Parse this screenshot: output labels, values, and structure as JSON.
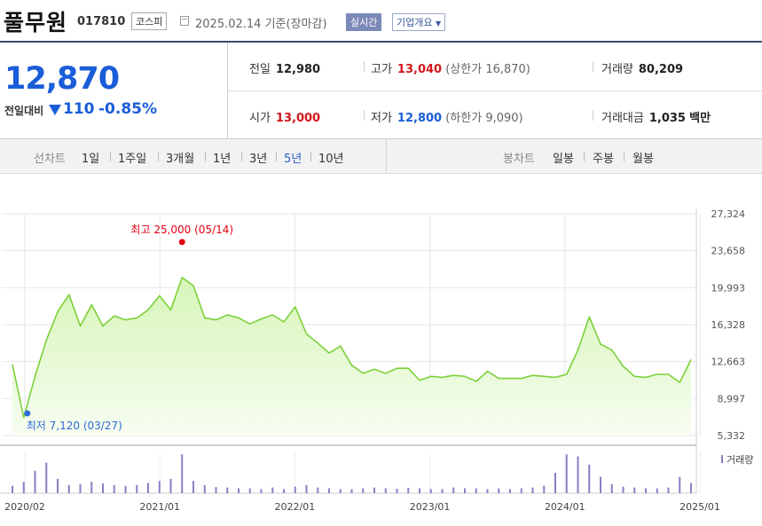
{
  "header": {
    "name": "풀무원",
    "code": "017810",
    "market": "코스피",
    "date": "2025.02.14",
    "date_suffix": "기준(장마감)",
    "realtime": "실시간",
    "company_info": "기업개요"
  },
  "quote": {
    "price": "12,870",
    "change_label": "전일대비",
    "change": "110",
    "change_pct": "-0.85%"
  },
  "stats": {
    "prev_close_label": "전일",
    "prev_close": "12,980",
    "high_label": "고가",
    "high": "13,040",
    "upper_limit": "(상한가 16,870)",
    "volume_label": "거래량",
    "volume": "80,209",
    "open_label": "시가",
    "open": "13,000",
    "low_label": "저가",
    "low": "12,800",
    "lower_limit": "(하한가 9,090)",
    "amount_label": "거래대금",
    "amount": "1,035",
    "amount_unit": "백만"
  },
  "tabs": {
    "line_label": "선차트",
    "line_periods": [
      "1일",
      "1주일",
      "3개월",
      "1년",
      "3년",
      "5년",
      "10년"
    ],
    "active_period": "5년",
    "candle_label": "봉차트",
    "candle_periods": [
      "일봉",
      "주봉",
      "월봉"
    ]
  },
  "colors": {
    "line": "#7cd13a",
    "area_top": "#d6f5b8",
    "area_bottom": "#f7fdf1",
    "volume": "#8a7fc6",
    "max": "#e10011",
    "min": "#2e6bd6"
  },
  "chart_data": {
    "type": "area",
    "ylim": [
      5332,
      27324
    ],
    "y_ticks": [
      "27,324",
      "23,658",
      "19,993",
      "16,328",
      "12,663",
      "8,997",
      "5,332"
    ],
    "x_ticks": [
      "2020/02",
      "2021/01",
      "2022/01",
      "2023/01",
      "2024/01",
      "2025/01"
    ],
    "max_label": "최고 25,000 (05/14)",
    "min_label": "최저 7,120 (03/27)",
    "volume_label": "거래량",
    "series": [
      {
        "x": [
          "2020-02",
          "2020-03",
          "2020-04",
          "2020-05",
          "2020-06",
          "2020-07",
          "2020-08",
          "2020-09",
          "2020-10",
          "2020-11",
          "2020-12",
          "2021-01",
          "2021-02",
          "2021-03",
          "2021-04",
          "2021-05",
          "2021-06",
          "2021-07",
          "2021-08",
          "2021-09",
          "2021-10",
          "2021-11",
          "2021-12",
          "2022-01",
          "2022-02",
          "2022-03",
          "2022-04",
          "2022-05",
          "2022-06",
          "2022-07",
          "2022-08",
          "2022-09",
          "2022-10",
          "2022-11",
          "2022-12",
          "2023-01",
          "2023-02",
          "2023-03",
          "2023-04",
          "2023-05",
          "2023-06",
          "2023-07",
          "2023-08",
          "2023-09",
          "2023-10",
          "2023-11",
          "2023-12",
          "2024-01",
          "2024-02",
          "2024-03",
          "2024-04",
          "2024-05",
          "2024-06",
          "2024-07",
          "2024-08",
          "2024-09",
          "2024-10",
          "2024-11",
          "2024-12",
          "2025-01",
          "2025-02"
        ],
        "values": [
          12400,
          7120,
          11200,
          14800,
          17600,
          19300,
          16200,
          18300,
          16200,
          17200,
          16800,
          17000,
          17800,
          19200,
          17800,
          21000,
          20200,
          17000,
          16800,
          17300,
          17000,
          16400,
          16900,
          17300,
          16600,
          18100,
          15400,
          14500,
          13500,
          14200,
          12300,
          11500,
          11900,
          11500,
          12000,
          12000,
          10800,
          11200,
          11100,
          11300,
          11200,
          10700,
          11700,
          11000,
          11000,
          11000,
          11300,
          11200,
          11100,
          11400,
          13800,
          17100,
          14400,
          13800,
          12200,
          11200,
          11100,
          11400,
          11400,
          10600,
          12870
        ]
      },
      {
        "name": "거래량",
        "x": [
          "2020-02",
          "2020-03",
          "2020-04",
          "2020-05",
          "2020-06",
          "2020-07",
          "2020-08",
          "2020-09",
          "2020-10",
          "2020-11",
          "2020-12",
          "2021-01",
          "2021-02",
          "2021-03",
          "2021-04",
          "2021-05",
          "2021-06",
          "2021-07",
          "2021-08",
          "2021-09",
          "2021-10",
          "2021-11",
          "2021-12",
          "2022-01",
          "2022-02",
          "2022-03",
          "2022-04",
          "2022-05",
          "2022-06",
          "2022-07",
          "2022-08",
          "2022-09",
          "2022-10",
          "2022-11",
          "2022-12",
          "2023-01",
          "2023-02",
          "2023-03",
          "2023-04",
          "2023-05",
          "2023-06",
          "2023-07",
          "2023-08",
          "2023-09",
          "2023-10",
          "2023-11",
          "2023-12",
          "2024-01",
          "2024-02",
          "2024-03",
          "2024-04",
          "2024-05",
          "2024-06",
          "2024-07",
          "2024-08",
          "2024-09",
          "2024-10",
          "2024-11",
          "2024-12",
          "2025-01",
          "2025-02"
        ],
        "values": [
          0.18,
          0.28,
          0.55,
          0.75,
          0.35,
          0.2,
          0.22,
          0.28,
          0.24,
          0.2,
          0.18,
          0.2,
          0.25,
          0.3,
          0.35,
          0.95,
          0.3,
          0.2,
          0.15,
          0.14,
          0.12,
          0.12,
          0.1,
          0.14,
          0.1,
          0.16,
          0.2,
          0.14,
          0.12,
          0.1,
          0.1,
          0.12,
          0.14,
          0.12,
          0.11,
          0.13,
          0.12,
          0.1,
          0.1,
          0.14,
          0.12,
          0.12,
          0.1,
          0.12,
          0.1,
          0.12,
          0.14,
          0.18,
          0.5,
          0.95,
          0.9,
          0.7,
          0.4,
          0.22,
          0.16,
          0.14,
          0.12,
          0.12,
          0.14,
          0.4,
          0.25
        ]
      }
    ]
  }
}
